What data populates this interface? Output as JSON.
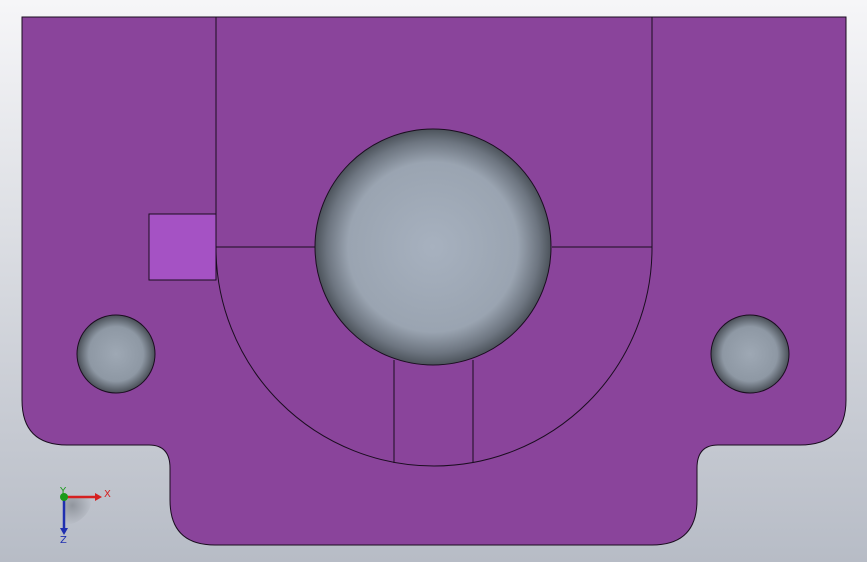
{
  "viewport": {
    "background_top": "#f6f6f8",
    "background_bottom": "#b7bcc6"
  },
  "part": {
    "face_color": "#8a449b",
    "face_highlight": "#a552c4",
    "edge_color": "#1a0d1f",
    "bore_color_center": "#a7b1bf",
    "bore_color_edge": "#4c535b"
  },
  "triad": {
    "x_label": "X",
    "y_label": "Y",
    "z_label": "Z",
    "x_color": "#d52020",
    "y_color": "#1a9a1a",
    "z_color": "#1f2fb0"
  }
}
